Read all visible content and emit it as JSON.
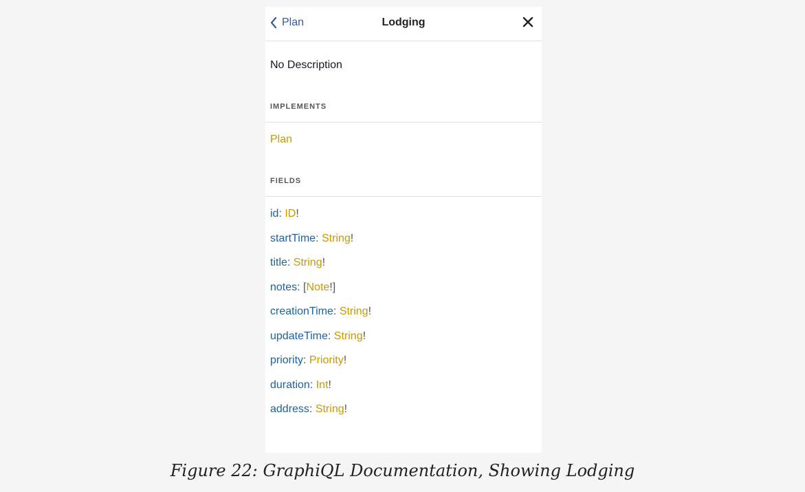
{
  "header": {
    "back_label": "Plan",
    "title": "Lodging"
  },
  "description": "No Description",
  "implements": {
    "heading": "IMPLEMENTS",
    "items": [
      "Plan"
    ]
  },
  "fields": {
    "heading": "FIELDS",
    "items": [
      {
        "name": "id",
        "type": "ID",
        "prefix": "",
        "suffix": "!"
      },
      {
        "name": "startTime",
        "type": "String",
        "prefix": "",
        "suffix": "!"
      },
      {
        "name": "title",
        "type": "String",
        "prefix": "",
        "suffix": "!"
      },
      {
        "name": "notes",
        "type": "Note",
        "prefix": "[",
        "suffix": "!]"
      },
      {
        "name": "creationTime",
        "type": "String",
        "prefix": "",
        "suffix": "!"
      },
      {
        "name": "updateTime",
        "type": "String",
        "prefix": "",
        "suffix": "!"
      },
      {
        "name": "priority",
        "type": "Priority",
        "prefix": "",
        "suffix": "!"
      },
      {
        "name": "duration",
        "type": "Int",
        "prefix": "",
        "suffix": "!"
      },
      {
        "name": "address",
        "type": "String",
        "prefix": "",
        "suffix": "!"
      }
    ]
  },
  "caption": "Figure 22: GraphiQL Documentation, Showing Lodging",
  "colors": {
    "field_name": "#1f61a0",
    "type_name": "#ca9800",
    "back_link": "#3b5998"
  },
  "icons": {
    "back": "chevron-left-icon",
    "close": "close-icon"
  }
}
